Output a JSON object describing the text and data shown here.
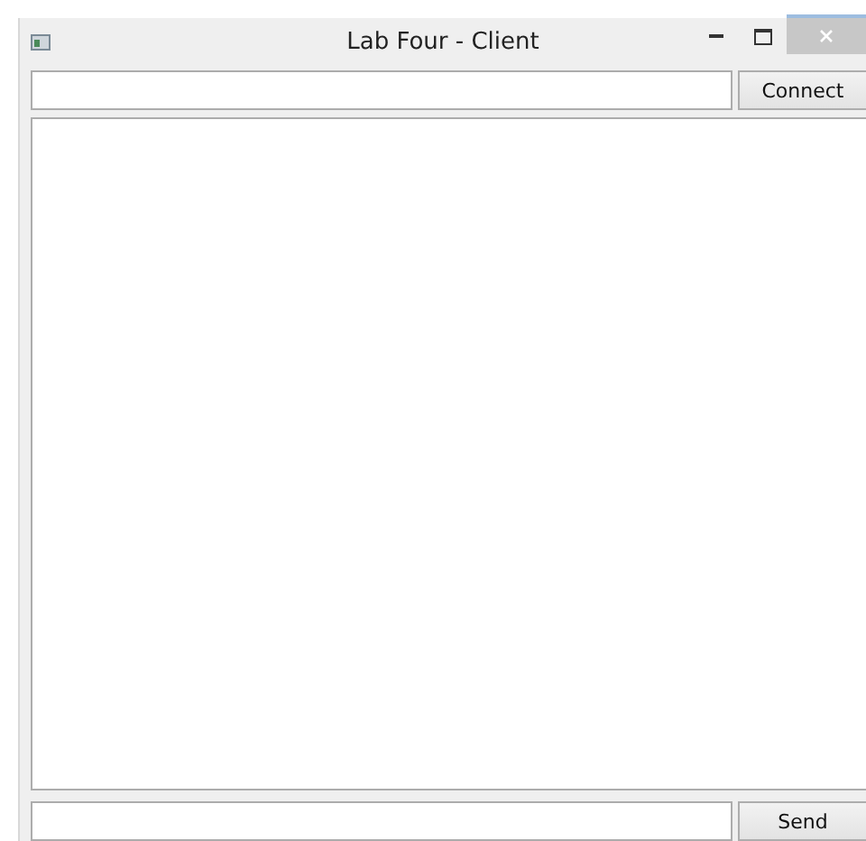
{
  "window": {
    "title": "Lab Four - Client"
  },
  "connect_bar": {
    "button": "Connect"
  },
  "send_bar": {
    "button": "Send"
  }
}
